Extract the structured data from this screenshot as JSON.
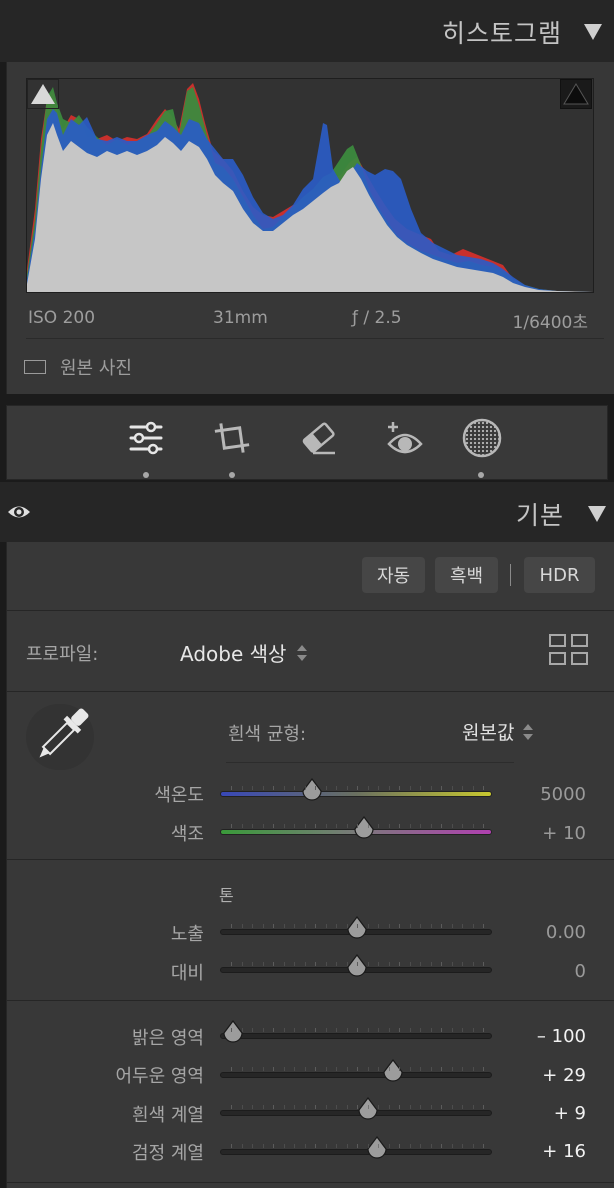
{
  "histogram_panel": {
    "title": "히스토그램",
    "iso": "ISO 200",
    "focal_length": "31mm",
    "aperture": "ƒ / 2.5",
    "shutter": "1/6400초",
    "original_photo_label": "원본 사진"
  },
  "toolbar": {
    "tools": [
      "edit-sliders-icon",
      "crop-icon",
      "eraser-icon",
      "red-eye-icon",
      "mask-icon"
    ]
  },
  "basic_panel": {
    "title": "기본",
    "auto_button": "자동",
    "bw_button": "흑백",
    "hdr_button": "HDR",
    "profile_label": "프로파일:",
    "profile_value": "Adobe 색상",
    "wb_label": "흰색 균형:",
    "wb_value": "원본값",
    "temp_label": "색온도",
    "temp_value": "5000",
    "temp_level": 0.32,
    "tint_label": "색조",
    "tint_value": "+ 10",
    "tint_level": 0.53,
    "tone_label": "톤",
    "exposure_label": "노출",
    "exposure_value": "0.00",
    "exposure_level": 0.5,
    "contrast_label": "대비",
    "contrast_value": "0",
    "contrast_level": 0.5,
    "highlights_label": "밝은 영역",
    "highlights_value": "– 100",
    "highlights_level": 0.0,
    "shadows_label": "어두운 영역",
    "shadows_value": "+ 29",
    "shadows_level": 0.645,
    "whites_label": "흰색 계열",
    "whites_value": "+ 9",
    "whites_level": 0.545,
    "blacks_label": "검정 계열",
    "blacks_value": "+ 16",
    "blacks_level": 0.58
  },
  "colors": {
    "panel_bg": "#383838",
    "header_bg": "#262626",
    "hist_red": "#c8302c",
    "hist_green": "#3c8a3e",
    "hist_blue": "#2a5cc8",
    "hist_luma": "#c6c6c6"
  }
}
